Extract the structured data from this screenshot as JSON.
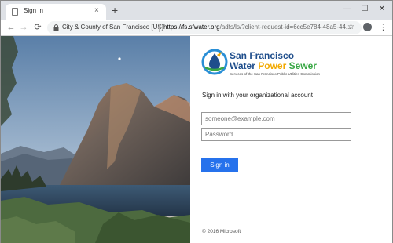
{
  "browser": {
    "tab": {
      "title": "Sign In",
      "close_glyph": "×"
    },
    "new_tab_glyph": "+",
    "window_controls": {
      "minimize": "—",
      "maximize": "☐",
      "close": "✕"
    },
    "nav": {
      "back": "←",
      "forward": "→",
      "reload": "⟳"
    },
    "address_bar": {
      "certificate_label": "City & County of San Francisco [US]",
      "url_host": "https://fs.sfwater.org",
      "url_path": "/adfs/ls/?client-request-id=6cc5e784-48a5-44..."
    },
    "toolbar_icons": {
      "bookmark": "☆",
      "menu": "⋮"
    }
  },
  "logo": {
    "line1": "San Francisco",
    "water": "Water",
    "power": "Power",
    "sewer": "Sewer",
    "tagline": "Services of the San Francisco Public Utilities Commission"
  },
  "signin": {
    "prompt": "Sign in with your organizational account",
    "email_placeholder": "someone@example.com",
    "password_placeholder": "Password",
    "button_label": "Sign in"
  },
  "footer": {
    "copyright": "© 2016 Microsoft"
  },
  "colors": {
    "brand_blue": "#1f4e8c",
    "power_yellow": "#f2a900",
    "sewer_green": "#39a845",
    "button_blue": "#2672ec"
  },
  "icons": [
    "page-favicon-icon",
    "close-icon",
    "plus-icon",
    "minimize-icon",
    "maximize-icon",
    "close-window-icon",
    "back-arrow-icon",
    "forward-arrow-icon",
    "reload-icon",
    "lock-icon",
    "star-icon",
    "profile-icon",
    "kebab-menu-icon"
  ]
}
